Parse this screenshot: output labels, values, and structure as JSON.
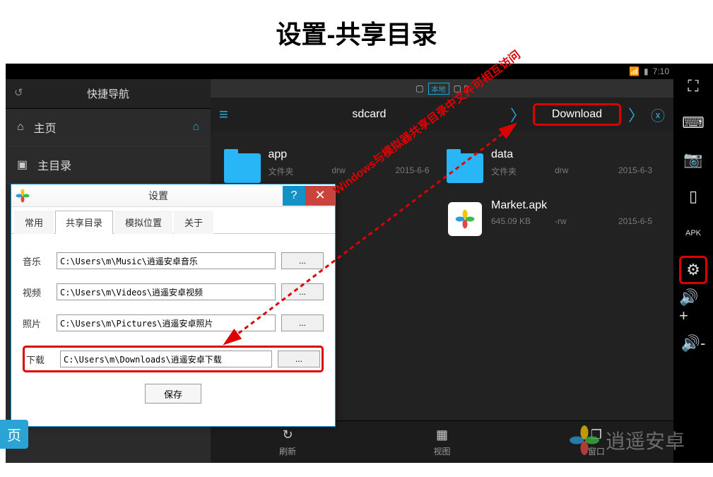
{
  "page_title": "设置-共享目录",
  "statusbar": {
    "time": "7:10"
  },
  "sidebar": {
    "header": "快捷导航",
    "items": [
      {
        "label": "主页",
        "icon": "home"
      },
      {
        "label": "主目录",
        "icon": "folder"
      }
    ]
  },
  "locationbar": {
    "label": "本地"
  },
  "breadcrumb": {
    "crumb1": "sdcard",
    "crumb2": "Download"
  },
  "files": [
    {
      "name": "app",
      "type_label": "文件夹",
      "perm": "drw",
      "date": "2015-6-6"
    },
    {
      "name": "data",
      "type_label": "文件夹",
      "perm": "drw",
      "date": "2015-6-3"
    },
    {
      "name": "Market.apk",
      "type_label": "645.09 KB",
      "perm": "-rw",
      "date": "2015-6-5"
    }
  ],
  "bottombar": {
    "refresh": "刷新",
    "view": "视图",
    "windows": "窗口"
  },
  "settings_dialog": {
    "title": "设置",
    "tabs": [
      "常用",
      "共享目录",
      "模拟位置",
      "关于"
    ],
    "rows": [
      {
        "label": "音乐",
        "path": "C:\\Users\\m\\Music\\逍遥安卓音乐"
      },
      {
        "label": "视频",
        "path": "C:\\Users\\m\\Videos\\逍遥安卓视频"
      },
      {
        "label": "照片",
        "path": "C:\\Users\\m\\Pictures\\逍遥安卓照片"
      },
      {
        "label": "下载",
        "path": "C:\\Users\\m\\Downloads\\逍遥安卓下载"
      }
    ],
    "browse_label": "...",
    "save_label": "保存"
  },
  "annotation": "Windows与模拟器共享目录中文件可相互访问",
  "watermark": "逍遥安卓",
  "page_tab_label": "页"
}
